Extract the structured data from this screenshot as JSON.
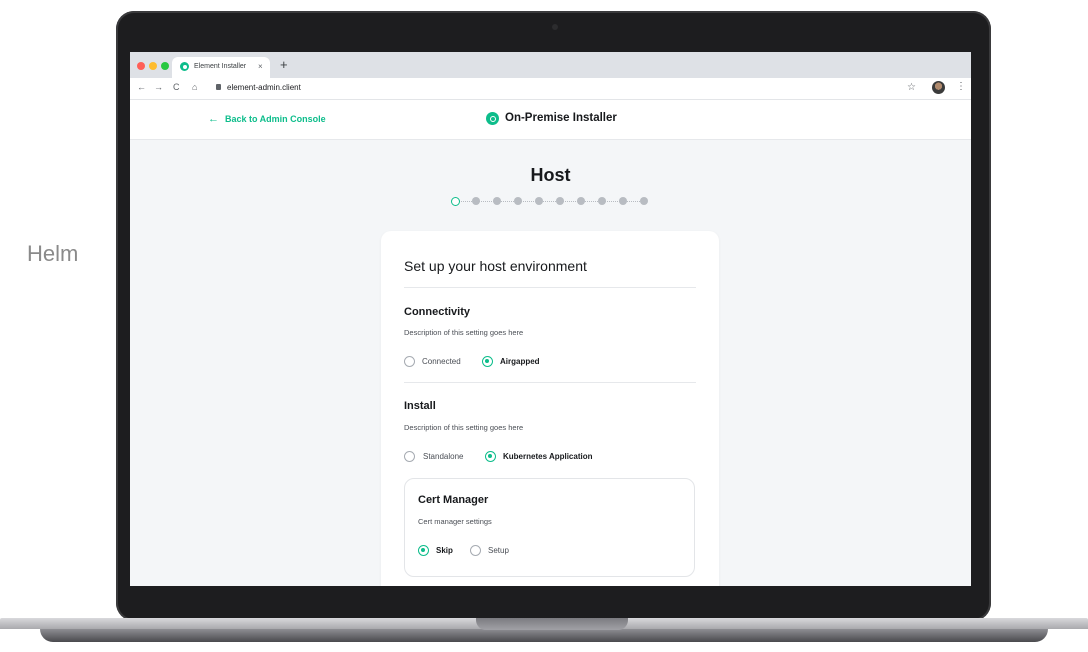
{
  "side_label": "Helm",
  "browser": {
    "tab_title": "Element Installer",
    "tab_close": "×",
    "new_tab": "+",
    "url": "element-admin.client",
    "nav": {
      "back": "←",
      "forward": "→",
      "reload": "C",
      "home": "⌂"
    },
    "star": "☆",
    "menu": "⋮"
  },
  "header": {
    "back_arrow": "←",
    "back_label": "Back to Admin Console",
    "title": "On-Premise Installer"
  },
  "step": {
    "title": "Host",
    "total_steps": 10,
    "current_step": 1
  },
  "card": {
    "title": "Set up your host environment",
    "connectivity": {
      "title": "Connectivity",
      "description": "Description of this setting goes here",
      "options": [
        "Connected",
        "Airgapped"
      ],
      "selected": "Airgapped"
    },
    "install": {
      "title": "Install",
      "description": "Description of this setting goes here",
      "options": [
        "Standalone",
        "Kubernetes Application"
      ],
      "selected": "Kubernetes Application"
    },
    "cert_manager": {
      "title": "Cert Manager",
      "description": "Cert manager settings",
      "options": [
        "Skip",
        "Setup"
      ],
      "selected": "Skip"
    }
  },
  "colors": {
    "accent": "#0dbd8b",
    "text": "#17191c",
    "page_bg": "#f4f6f8"
  }
}
